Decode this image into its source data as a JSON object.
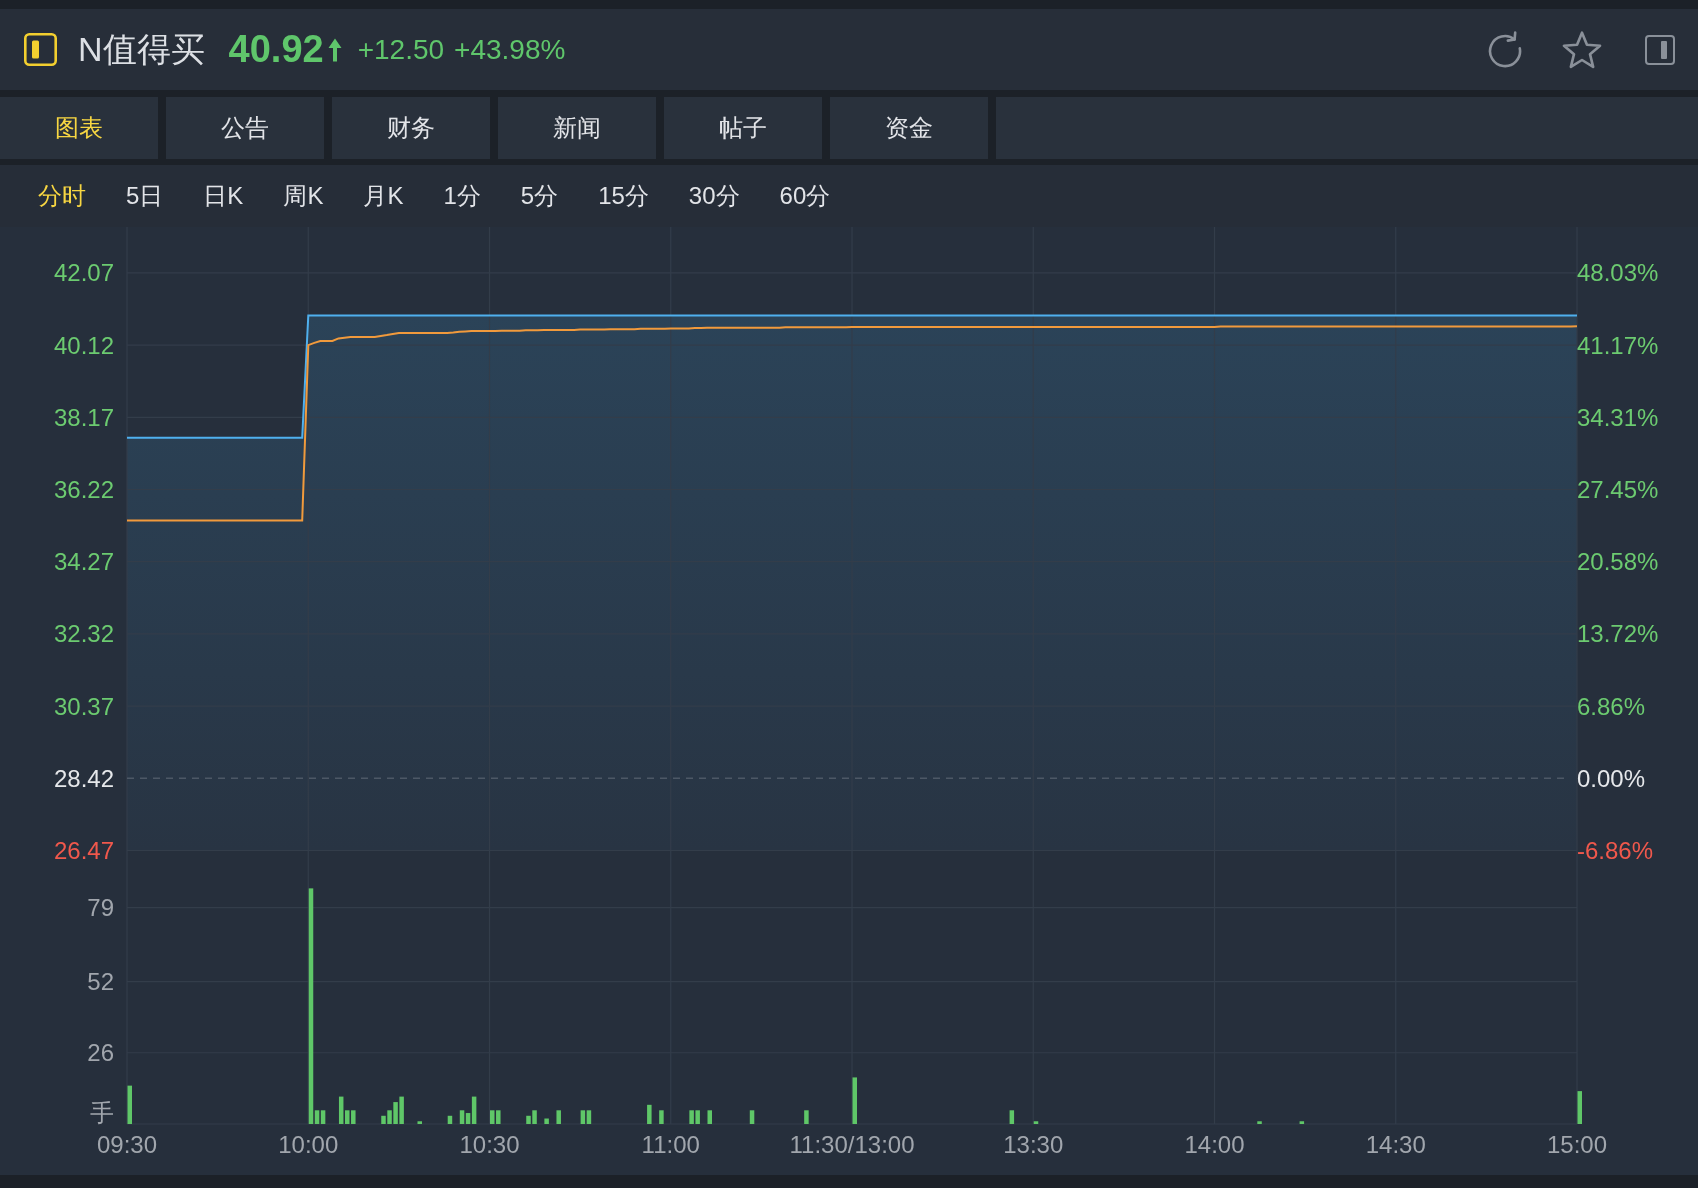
{
  "header": {
    "symbol": "N值得买",
    "quote": {
      "price": "40.92",
      "change": "+12.50",
      "change_percent": "+43.98%",
      "up": true
    }
  },
  "tabs": [
    {
      "label": "图表",
      "selected": true
    },
    {
      "label": "公告",
      "selected": false
    },
    {
      "label": "财务",
      "selected": false
    },
    {
      "label": "新闻",
      "selected": false
    },
    {
      "label": "帖子",
      "selected": false
    },
    {
      "label": "资金",
      "selected": false
    }
  ],
  "periods": [
    {
      "label": "分时",
      "selected": true
    },
    {
      "label": "5日",
      "selected": false
    },
    {
      "label": "日K",
      "selected": false
    },
    {
      "label": "周K",
      "selected": false
    },
    {
      "label": "月K",
      "selected": false
    },
    {
      "label": "1分",
      "selected": false
    },
    {
      "label": "5分",
      "selected": false
    },
    {
      "label": "15分",
      "selected": false
    },
    {
      "label": "30分",
      "selected": false
    },
    {
      "label": "60分",
      "selected": false
    }
  ],
  "price_chart": {
    "chart_data": {
      "type": "line",
      "grid": true,
      "categories": [
        null,
        null,
        null,
        null,
        null,
        null,
        null,
        null,
        null,
        null,
        null,
        null,
        null,
        null,
        null,
        null,
        null,
        null,
        null,
        null,
        null,
        null,
        null,
        null,
        null,
        null,
        null,
        null,
        null,
        null,
        null,
        null,
        null,
        null,
        null,
        null,
        null,
        null,
        null,
        null,
        null,
        null,
        null,
        null,
        null,
        null,
        null,
        null,
        null,
        null,
        null,
        null,
        null,
        null,
        null,
        null,
        null,
        null,
        null,
        null,
        null,
        null,
        null,
        null,
        null,
        null,
        null,
        null,
        null,
        null,
        null,
        null,
        null,
        null,
        null,
        null,
        null,
        null,
        null,
        null,
        null,
        null,
        null,
        null,
        null,
        null,
        null,
        null,
        null,
        null,
        null,
        null,
        null,
        null,
        null,
        null,
        null,
        null,
        null,
        null,
        null,
        null,
        null,
        null,
        null,
        null,
        null,
        null,
        null,
        null,
        null,
        null,
        null,
        null,
        null,
        null,
        null,
        null,
        null,
        null,
        null,
        null,
        null,
        null,
        null,
        null,
        null,
        null,
        null,
        null,
        null,
        null,
        null,
        null,
        null,
        null,
        null,
        null,
        null,
        null,
        null,
        null,
        null,
        null,
        null,
        null,
        null,
        null,
        null,
        null,
        null,
        null,
        null,
        null,
        null,
        null,
        null,
        null,
        null,
        null,
        null,
        null,
        null,
        null,
        null,
        null,
        null,
        null,
        null,
        null,
        null,
        null,
        null,
        null,
        null,
        null,
        null,
        null,
        null,
        null,
        null,
        null,
        null,
        null,
        null,
        null,
        null,
        null,
        null,
        null,
        null,
        null,
        null,
        null,
        null,
        null,
        null,
        null,
        null,
        null,
        null,
        null,
        null,
        null,
        null,
        null,
        null,
        null,
        null,
        null,
        null,
        null,
        null,
        null,
        null,
        null,
        null,
        null,
        null,
        null,
        null,
        null,
        null,
        null,
        null,
        null,
        null,
        null,
        null,
        null,
        null,
        null,
        null,
        null,
        null,
        null,
        null,
        null,
        null,
        null,
        null
      ],
      "ylim": [
        26.47,
        43.31
      ],
      "yticks": [
        42.07,
        40.12,
        38.17,
        36.22,
        34.27,
        32.32,
        30.37,
        28.42,
        26.47
      ],
      "series": [
        {
          "type": "area",
          "color": "#4fb0ee",
          "values": [
            37.62,
            37.62,
            37.62,
            37.62,
            37.62,
            37.62,
            37.62,
            37.62,
            37.62,
            37.62,
            37.62,
            37.62,
            37.62,
            37.62,
            37.62,
            37.62,
            37.62,
            37.62,
            37.62,
            37.62,
            37.62,
            37.62,
            37.62,
            37.62,
            37.62,
            37.62,
            37.62,
            37.62,
            37.62,
            37.62,
            40.92,
            40.92,
            40.92,
            40.92,
            40.92,
            40.92,
            40.92,
            40.92,
            40.92,
            40.92,
            40.92,
            40.92,
            40.92,
            40.92,
            40.92,
            40.92,
            40.92,
            40.92,
            40.92,
            40.92,
            40.92,
            40.92,
            40.92,
            40.92,
            40.92,
            40.92,
            40.92,
            40.92,
            40.92,
            40.92,
            40.92,
            40.92,
            40.92,
            40.92,
            40.92,
            40.92,
            40.92,
            40.92,
            40.92,
            40.92,
            40.92,
            40.92,
            40.92,
            40.92,
            40.92,
            40.92,
            40.92,
            40.92,
            40.92,
            40.92,
            40.92,
            40.92,
            40.92,
            40.92,
            40.92,
            40.92,
            40.92,
            40.92,
            40.92,
            40.92,
            40.92,
            40.92,
            40.92,
            40.92,
            40.92,
            40.92,
            40.92,
            40.92,
            40.92,
            40.92,
            40.92,
            40.92,
            40.92,
            40.92,
            40.92,
            40.92,
            40.92,
            40.92,
            40.92,
            40.92,
            40.92,
            40.92,
            40.92,
            40.92,
            40.92,
            40.92,
            40.92,
            40.92,
            40.92,
            40.92,
            40.92,
            40.92,
            40.92,
            40.92,
            40.92,
            40.92,
            40.92,
            40.92,
            40.92,
            40.92,
            40.92,
            40.92,
            40.92,
            40.92,
            40.92,
            40.92,
            40.92,
            40.92,
            40.92,
            40.92,
            40.92,
            40.92,
            40.92,
            40.92,
            40.92,
            40.92,
            40.92,
            40.92,
            40.92,
            40.92,
            40.92,
            40.92,
            40.92,
            40.92,
            40.92,
            40.92,
            40.92,
            40.92,
            40.92,
            40.92,
            40.92,
            40.92,
            40.92,
            40.92,
            40.92,
            40.92,
            40.92,
            40.92,
            40.92,
            40.92,
            40.92,
            40.92,
            40.92,
            40.92,
            40.92,
            40.92,
            40.92,
            40.92,
            40.92,
            40.92,
            40.92,
            40.92,
            40.92,
            40.92,
            40.92,
            40.92,
            40.92,
            40.92,
            40.92,
            40.92,
            40.92,
            40.92,
            40.92,
            40.92,
            40.92,
            40.92,
            40.92,
            40.92,
            40.92,
            40.92,
            40.92,
            40.92,
            40.92,
            40.92,
            40.92,
            40.92,
            40.92,
            40.92,
            40.92,
            40.92,
            40.92,
            40.92,
            40.92,
            40.92,
            40.92,
            40.92,
            40.92,
            40.92,
            40.92,
            40.92,
            40.92,
            40.92,
            40.92,
            40.92,
            40.92,
            40.92,
            40.92,
            40.92,
            40.92,
            40.92,
            40.92,
            40.92,
            40.92,
            40.92,
            40.92,
            40.92,
            40.92,
            40.92,
            40.92,
            40.92,
            40.92
          ]
        },
        {
          "type": "line",
          "color": "#f19a3c",
          "values": [
            35.38,
            35.38,
            35.38,
            35.38,
            35.38,
            35.38,
            35.38,
            35.38,
            35.38,
            35.38,
            35.38,
            35.38,
            35.38,
            35.38,
            35.38,
            35.38,
            35.38,
            35.38,
            35.38,
            35.38,
            35.38,
            35.38,
            35.38,
            35.38,
            35.38,
            35.38,
            35.38,
            35.38,
            35.38,
            35.38,
            40.12,
            40.18,
            40.23,
            40.23,
            40.23,
            40.3,
            40.32,
            40.34,
            40.34,
            40.34,
            40.34,
            40.34,
            40.37,
            40.39,
            40.42,
            40.45,
            40.45,
            40.45,
            40.45,
            40.45,
            40.45,
            40.45,
            40.45,
            40.45,
            40.46,
            40.48,
            40.49,
            40.5,
            40.5,
            40.5,
            40.5,
            40.5,
            40.51,
            40.51,
            40.51,
            40.51,
            40.52,
            40.52,
            40.52,
            40.53,
            40.53,
            40.53,
            40.53,
            40.53,
            40.53,
            40.54,
            40.54,
            40.54,
            40.54,
            40.54,
            40.55,
            40.55,
            40.55,
            40.55,
            40.55,
            40.56,
            40.56,
            40.56,
            40.56,
            40.56,
            40.57,
            40.57,
            40.57,
            40.57,
            40.58,
            40.58,
            40.59,
            40.59,
            40.59,
            40.59,
            40.59,
            40.59,
            40.59,
            40.59,
            40.59,
            40.59,
            40.59,
            40.59,
            40.59,
            40.6,
            40.6,
            40.6,
            40.6,
            40.6,
            40.6,
            40.6,
            40.6,
            40.6,
            40.6,
            40.6,
            40.61,
            40.61,
            40.61,
            40.61,
            40.61,
            40.61,
            40.61,
            40.61,
            40.61,
            40.61,
            40.61,
            40.61,
            40.61,
            40.61,
            40.61,
            40.61,
            40.61,
            40.61,
            40.61,
            40.61,
            40.61,
            40.61,
            40.61,
            40.61,
            40.61,
            40.61,
            40.61,
            40.61,
            40.61,
            40.61,
            40.61,
            40.61,
            40.61,
            40.61,
            40.61,
            40.61,
            40.61,
            40.61,
            40.61,
            40.61,
            40.61,
            40.61,
            40.61,
            40.61,
            40.61,
            40.61,
            40.61,
            40.61,
            40.61,
            40.61,
            40.61,
            40.61,
            40.61,
            40.61,
            40.61,
            40.61,
            40.61,
            40.61,
            40.61,
            40.61,
            40.61,
            40.62,
            40.62,
            40.62,
            40.62,
            40.62,
            40.62,
            40.62,
            40.62,
            40.62,
            40.62,
            40.62,
            40.62,
            40.62,
            40.62,
            40.62,
            40.62,
            40.62,
            40.62,
            40.62,
            40.62,
            40.62,
            40.62,
            40.62,
            40.62,
            40.62,
            40.62,
            40.62,
            40.62,
            40.62,
            40.62,
            40.62,
            40.62,
            40.62,
            40.62,
            40.62,
            40.62,
            40.62,
            40.62,
            40.62,
            40.62,
            40.62,
            40.62,
            40.62,
            40.62,
            40.62,
            40.62,
            40.62,
            40.62,
            40.62,
            40.62,
            40.62,
            40.62,
            40.62,
            40.62,
            40.62,
            40.62,
            40.62,
            40.62,
            40.62,
            40.63
          ]
        }
      ],
      "ref_lines": [
        {
          "axis": "y",
          "value": 28.42
        }
      ]
    },
    "percent_labels": [
      "48.03%",
      "41.17%",
      "34.31%",
      "27.45%",
      "20.58%",
      "13.72%",
      "6.86%",
      "0.00%",
      "-6.86%"
    ]
  },
  "volume_chart": {
    "chart_data": {
      "type": "bar",
      "grid": true,
      "categories": [
        "09:30",
        null,
        null,
        null,
        null,
        null,
        null,
        null,
        null,
        null,
        null,
        null,
        null,
        null,
        null,
        null,
        null,
        null,
        null,
        null,
        null,
        null,
        null,
        null,
        null,
        null,
        null,
        null,
        null,
        null,
        "10:00",
        null,
        null,
        null,
        null,
        null,
        null,
        null,
        null,
        null,
        null,
        null,
        null,
        null,
        null,
        null,
        null,
        null,
        null,
        null,
        null,
        null,
        null,
        null,
        null,
        null,
        null,
        null,
        null,
        null,
        "10:30",
        null,
        null,
        null,
        null,
        null,
        null,
        null,
        null,
        null,
        null,
        null,
        null,
        null,
        null,
        null,
        null,
        null,
        null,
        null,
        null,
        null,
        null,
        null,
        null,
        null,
        null,
        null,
        null,
        null,
        "11:00",
        null,
        null,
        null,
        null,
        null,
        null,
        null,
        null,
        null,
        null,
        null,
        null,
        null,
        null,
        null,
        null,
        null,
        null,
        null,
        null,
        null,
        null,
        null,
        null,
        null,
        null,
        null,
        null,
        null,
        "11:30/13:00",
        null,
        null,
        null,
        null,
        null,
        null,
        null,
        null,
        null,
        null,
        null,
        null,
        null,
        null,
        null,
        null,
        null,
        null,
        null,
        null,
        null,
        null,
        null,
        null,
        null,
        null,
        null,
        null,
        null,
        "13:30",
        null,
        null,
        null,
        null,
        null,
        null,
        null,
        null,
        null,
        null,
        null,
        null,
        null,
        null,
        null,
        null,
        null,
        null,
        null,
        null,
        null,
        null,
        null,
        null,
        null,
        null,
        null,
        null,
        null,
        "14:00",
        null,
        null,
        null,
        null,
        null,
        null,
        null,
        null,
        null,
        null,
        null,
        null,
        null,
        null,
        null,
        null,
        null,
        null,
        null,
        null,
        null,
        null,
        null,
        null,
        null,
        null,
        null,
        null,
        null,
        "14:30",
        null,
        null,
        null,
        null,
        null,
        null,
        null,
        null,
        null,
        null,
        null,
        null,
        null,
        null,
        null,
        null,
        null,
        null,
        null,
        null,
        null,
        null,
        null,
        null,
        null,
        null,
        null,
        null,
        null,
        "15:00"
      ],
      "values": [
        14,
        0,
        0,
        0,
        0,
        0,
        0,
        0,
        0,
        0,
        0,
        0,
        0,
        0,
        0,
        0,
        0,
        0,
        0,
        0,
        0,
        0,
        0,
        0,
        0,
        0,
        0,
        0,
        0,
        0,
        86,
        5,
        5,
        0,
        0,
        10,
        5,
        5,
        0,
        0,
        0,
        0,
        3,
        5,
        8,
        10,
        0,
        0,
        1,
        0,
        0,
        0,
        0,
        3,
        0,
        5,
        4,
        10,
        0,
        0,
        5,
        5,
        0,
        0,
        0,
        0,
        3,
        5,
        0,
        2,
        0,
        5,
        0,
        0,
        0,
        5,
        5,
        0,
        0,
        0,
        0,
        0,
        0,
        0,
        0,
        0,
        7,
        0,
        5,
        0,
        0,
        0,
        0,
        5,
        5,
        0,
        5,
        0,
        0,
        0,
        0,
        0,
        0,
        5,
        0,
        0,
        0,
        0,
        0,
        0,
        0,
        0,
        5,
        0,
        0,
        0,
        0,
        0,
        0,
        0,
        17,
        0,
        0,
        0,
        0,
        0,
        0,
        0,
        0,
        0,
        0,
        0,
        0,
        0,
        0,
        0,
        0,
        0,
        0,
        0,
        0,
        0,
        0,
        0,
        0,
        0,
        5,
        0,
        0,
        0,
        1,
        0,
        0,
        0,
        0,
        0,
        0,
        0,
        0,
        0,
        0,
        0,
        0,
        0,
        0,
        0,
        0,
        0,
        0,
        0,
        0,
        0,
        0,
        0,
        0,
        0,
        0,
        0,
        0,
        0,
        0,
        0,
        0,
        0,
        0,
        0,
        0,
        1,
        0,
        0,
        0,
        0,
        0,
        0,
        1,
        0,
        0,
        0,
        0,
        0,
        0,
        0,
        0,
        0,
        0,
        0,
        0,
        0,
        0,
        0,
        0,
        0,
        0,
        0,
        0,
        0,
        0,
        0,
        0,
        0,
        0,
        0,
        0,
        0,
        0,
        0,
        0,
        0,
        0,
        0,
        0,
        0,
        0,
        0,
        0,
        0,
        0,
        0,
        0,
        0,
        12
      ],
      "ylim": [
        0,
        93.8
      ],
      "yticks": [
        {
          "value": 0,
          "label": "手"
        },
        26,
        52,
        79
      ]
    }
  }
}
